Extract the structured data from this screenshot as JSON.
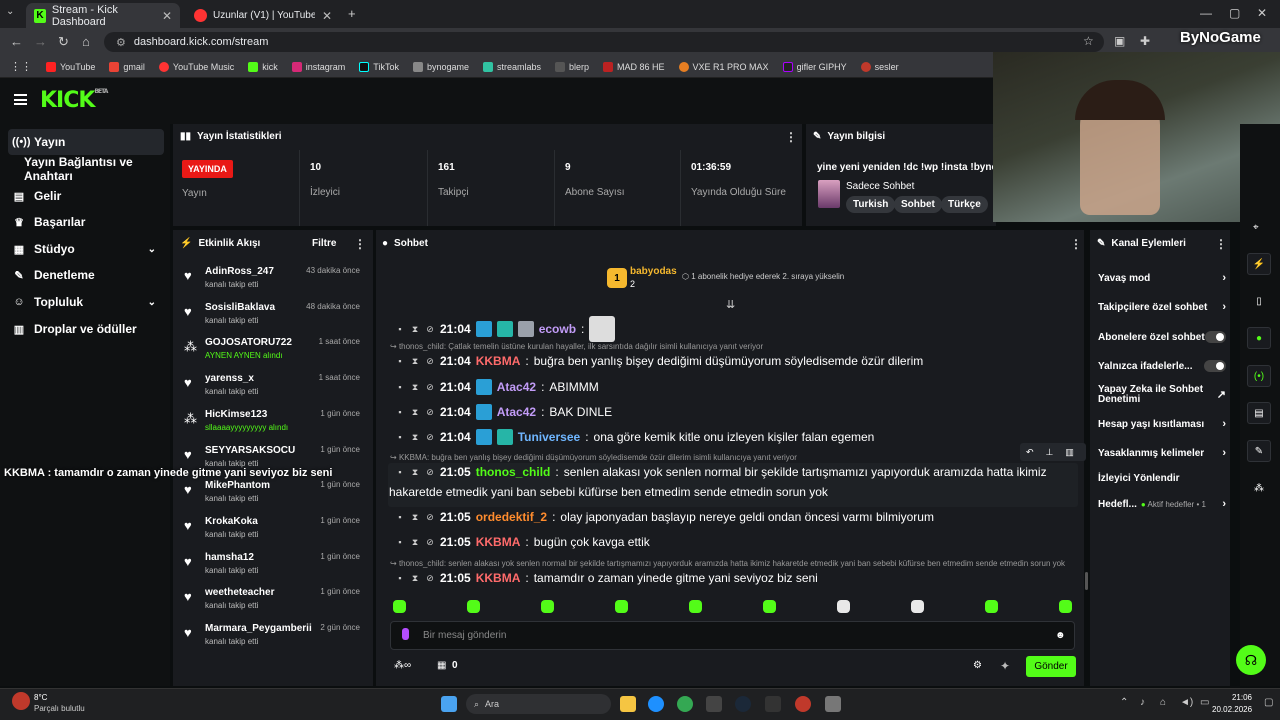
{
  "browser": {
    "tabs": [
      {
        "title": "Stream - Kick Dashboard"
      },
      {
        "title": "Uzunlar (V1) | YouTube Mus"
      }
    ],
    "url": "dashboard.kick.com/stream",
    "bookmarks": [
      "YouTube",
      "gmail",
      "YouTube Music",
      "kick",
      "instagram",
      "TikTok",
      "bynogame",
      "streamlabs",
      "blerp",
      "MAD 86 HE",
      "VXE R1 PRO MAX",
      "gifler GIPHY",
      "sesler"
    ],
    "watermark": "ByNoGame"
  },
  "sidebar": {
    "items": [
      {
        "label": "Yayın",
        "icon": "broadcast-icon"
      },
      {
        "label": "Yayın Bağlantısı ve Anahtarı",
        "icon": ""
      },
      {
        "label": "Gelir",
        "icon": "money-icon"
      },
      {
        "label": "Başarılar",
        "icon": "trophy-icon"
      },
      {
        "label": "Stüdyo",
        "icon": "studio-icon"
      },
      {
        "label": "Denetleme",
        "icon": "wrench-icon"
      },
      {
        "label": "Topluluk",
        "icon": "people-icon"
      },
      {
        "label": "Droplar ve ödüller",
        "icon": "gift-icon"
      }
    ]
  },
  "stats": {
    "title": "Yayın İstatistikleri",
    "live_badge": "YAYINDA",
    "live_label": "Yayın",
    "items": [
      {
        "value": "10",
        "label": "İzleyici"
      },
      {
        "value": "161",
        "label": "Takipçi"
      },
      {
        "value": "9",
        "label": "Abone Sayısı"
      },
      {
        "value": "01:36:59",
        "label": "Yayında Olduğu Süre"
      }
    ]
  },
  "stream_info": {
    "title": "Yayın bilgisi",
    "stream_title": "yine yeni yeniden !dc !wp !insta !bynog",
    "category": "Sadece Sohbet",
    "tags": [
      "Turkish",
      "Sohbet",
      "Türkçe"
    ]
  },
  "activity": {
    "title": "Etkinlik Akışı",
    "filter": "Filtre",
    "events": [
      {
        "name": "AdinRoss_247",
        "sub": "kanalı takip etti",
        "time": "43 dakika önce",
        "icon": "heart-icon",
        "green": false
      },
      {
        "name": "SosisliBaklava",
        "sub": "kanalı takip etti",
        "time": "48 dakika önce",
        "icon": "heart-icon",
        "green": false
      },
      {
        "name": "GOJOSATORU722",
        "sub": "AYNEN AYNEN alındı",
        "time": "1 saat önce",
        "icon": "reward-icon",
        "green": true
      },
      {
        "name": "yarenss_x",
        "sub": "kanalı takip etti",
        "time": "1 saat önce",
        "icon": "heart-icon",
        "green": false
      },
      {
        "name": "HicKimse123",
        "sub": "sllaaaayyyyyyyyy alındı",
        "time": "1 gün önce",
        "icon": "reward-icon",
        "green": true
      },
      {
        "name": "SEYYARSAKSOCU",
        "sub": "kanalı takip etti",
        "time": "1 gün önce",
        "icon": "heart-icon",
        "green": false
      },
      {
        "name": "MikePhantom",
        "sub": "kanalı takip etti",
        "time": "1 gün önce",
        "icon": "heart-icon",
        "green": false
      },
      {
        "name": "KrokaKoka",
        "sub": "kanalı takip etti",
        "time": "1 gün önce",
        "icon": "heart-icon",
        "green": false
      },
      {
        "name": "hamsha12",
        "sub": "kanalı takip etti",
        "time": "1 gün önce",
        "icon": "heart-icon",
        "green": false
      },
      {
        "name": "weetheteacher",
        "sub": "kanalı takip etti",
        "time": "1 gün önce",
        "icon": "heart-icon",
        "green": false
      },
      {
        "name": "Marmara_Peygamberii",
        "sub": "kanalı takip etti",
        "time": "2 gün önce",
        "icon": "heart-icon",
        "green": false
      }
    ]
  },
  "chat": {
    "title": "Sohbet",
    "pinned_user": "babyodas",
    "pinned_count": "2",
    "pinned_text": "1 abonelik hediye ederek 2. sıraya yükselin",
    "messages": [
      {
        "time": "21:04",
        "user": "ecowb",
        "color": "#c29cf7",
        "text": ""
      },
      {
        "time": "21:04",
        "user": "KKBMA",
        "color": "#ff6b6b",
        "text": "buğra ben yanlış bişey dediğimi düşümüyorum söyledisemde özür dilerim"
      },
      {
        "time": "21:04",
        "user": "Atac42",
        "color": "#c29cf7",
        "text": "ABIMMM"
      },
      {
        "time": "21:04",
        "user": "Atac42",
        "color": "#c29cf7",
        "text": "BAK DINLE"
      },
      {
        "time": "21:04",
        "user": "Tuniversee",
        "color": "#6fb6ff",
        "text": "ona göre kemik kitle onu izleyen kişiler falan egemen"
      },
      {
        "time": "21:05",
        "user": "thonos_child",
        "color": "#53fc18",
        "text": "senlen alakası yok senlen normal bir şekilde tartışmamızı yapıyorduk aramızda hatta ikimiz"
      },
      {
        "time": "21:05",
        "user": "ordedektif_2",
        "color": "#ff8c2e",
        "text": "olay japonyadan başlayıp nereye geldi ondan öncesi varmı bilmiyorum"
      },
      {
        "time": "21:05",
        "user": "KKBMA",
        "color": "#ff6b6b",
        "text": "bugün çok kavga ettik"
      },
      {
        "time": "21:05",
        "user": "KKBMA",
        "color": "#ff6b6b",
        "text": "tamamdır o zaman yinede gitme yani seviyoz biz seni"
      }
    ],
    "wrap_text": "hakaretde etmedik yani ban sebebi küfürse ben etmedim sende etmedin sorun yok",
    "reply1": "thonos_child: Çatlak temelin üstüne kurulan hayaller, ilk sarsıntıda dağılır isimli kullanıcıya yanıt veriyor",
    "reply2": "KKBMA: buğra ben yanlış bişey dediğimi düşümüyorum söyledisemde özür dilerim isimli kullanıcıya yanıt veriyor",
    "reply3": "thonos_child: senlen alakası yok senlen normal bir şekilde tartışmamızı yapıyorduk aramızda hatta ikimiz hakaretde etmedik yani ban sebebi küfürse ben etmedim sende etmedin sorun yok",
    "input_placeholder": "Bir mesaj gönderin",
    "points": "0",
    "send_label": "Gönder"
  },
  "overlay_text": "KKBMA : tamamdır o zaman yinede gitme yani seviyoz biz seni",
  "channel_actions": {
    "title": "Kanal Eylemleri",
    "items": [
      {
        "label": "Yavaş mod",
        "type": "chevron"
      },
      {
        "label": "Takipçilere özel sohbet",
        "type": "chevron"
      },
      {
        "label": "Abonelere özel sohbet",
        "type": "toggle"
      },
      {
        "label": "Yalnızca ifadelerle...",
        "type": "toggle"
      },
      {
        "label": "Yapay Zeka ile Sohbet Denetimi",
        "type": "external"
      },
      {
        "label": "Hesap yaşı kısıtlaması",
        "type": "chevron"
      },
      {
        "label": "Yasaklanmış kelimeler",
        "type": "chevron"
      },
      {
        "label": "İzleyici Yönlendir",
        "type": "none"
      },
      {
        "label": "Hedefl...",
        "type": "chevron"
      }
    ],
    "goal_status": "Aktif hedefler • 1"
  },
  "taskbar": {
    "weather_temp": "8°C",
    "weather_desc": "Parçalı bulutlu",
    "search": "Ara",
    "time": "21:06",
    "date": "20.02.2026"
  },
  "colors": {
    "accent": "#53fc18",
    "live": "#e91916"
  }
}
